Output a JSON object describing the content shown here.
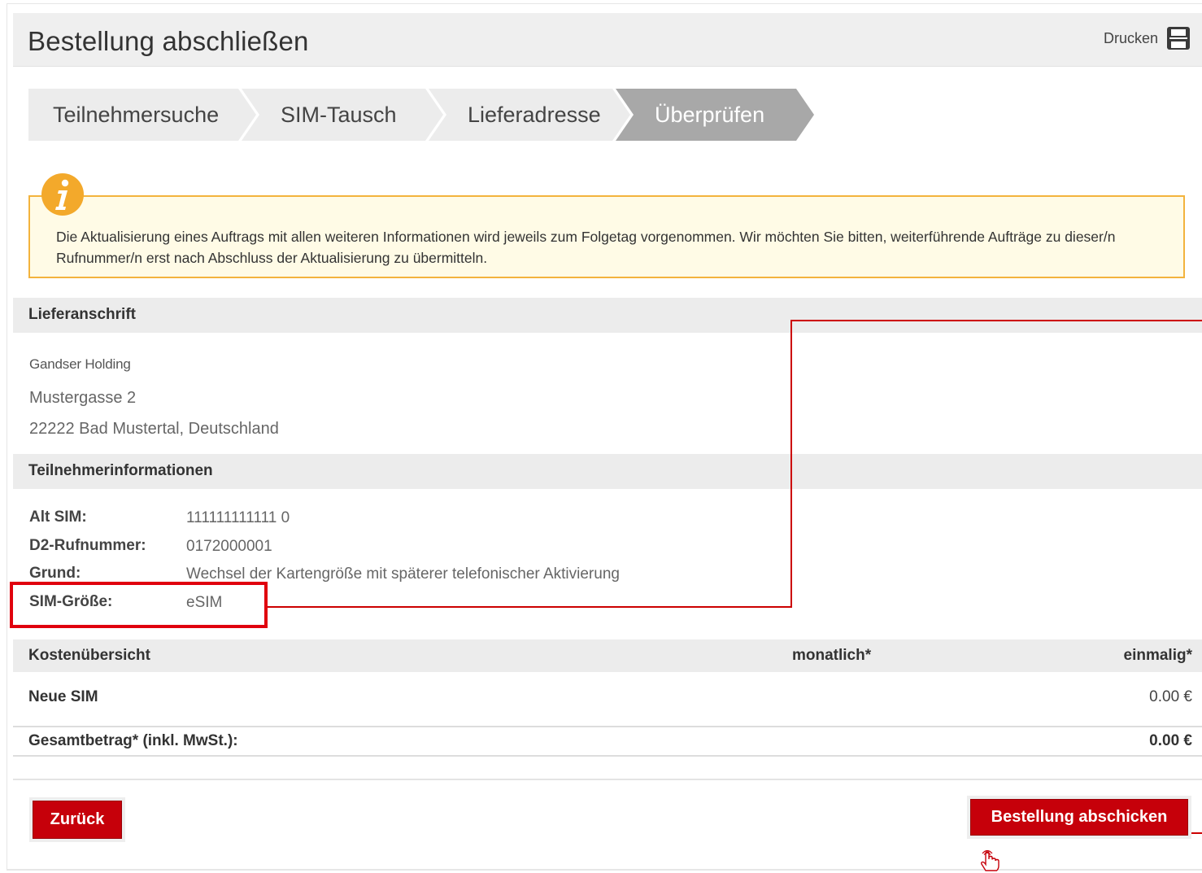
{
  "header": {
    "title": "Bestellung abschließen",
    "print_label": "Drucken",
    "print_icon": "printer-icon"
  },
  "steps": [
    {
      "label": "Teilnehmersuche",
      "active": false
    },
    {
      "label": "SIM-Tausch",
      "active": false
    },
    {
      "label": "Lieferadresse",
      "active": false
    },
    {
      "label": "Überprüfen",
      "active": true
    }
  ],
  "notice": {
    "icon": "info-icon",
    "text": "Die Aktualisierung eines Auftrags mit allen weiteren Informationen wird jeweils zum Folgetag vorgenommen. Wir möchten Sie bitten, weiterführende Aufträge zu dieser/n Rufnummer/n erst nach Abschluss der Aktualisierung zu übermitteln."
  },
  "delivery": {
    "heading": "Lieferanschrift",
    "company": "Gandser Holding",
    "street": "Mustergasse 2",
    "city": "22222 Bad Mustertal, Deutschland"
  },
  "subscriber": {
    "heading": "Teilnehmerinformationen",
    "rows": [
      {
        "label": "Alt SIM:",
        "value": "111111111111 0"
      },
      {
        "label": "D2-Rufnummer:",
        "value": "0172000001"
      },
      {
        "label": "Grund:",
        "value": "Wechsel der Kartengröße mit späterer telefonischer Aktivierung"
      },
      {
        "label": "SIM-Größe:",
        "value": "eSIM"
      }
    ]
  },
  "costs": {
    "heading": "Kostenübersicht",
    "col_monthly": "monatlich*",
    "col_once": "einmalig*",
    "item_label": "Neue SIM",
    "item_once": "0.00 €",
    "total_label": "Gesamtbetrag* (inkl. MwSt.):",
    "total_once": "0.00 €"
  },
  "buttons": {
    "back": "Zurück",
    "submit": "Bestellung abschicken"
  },
  "colors": {
    "brand_red": "#c6000a",
    "highlight_red": "#e0000e",
    "notice_border": "#f3b33d",
    "notice_bg": "#fffbe6",
    "active_step": "#a8a8a8"
  }
}
